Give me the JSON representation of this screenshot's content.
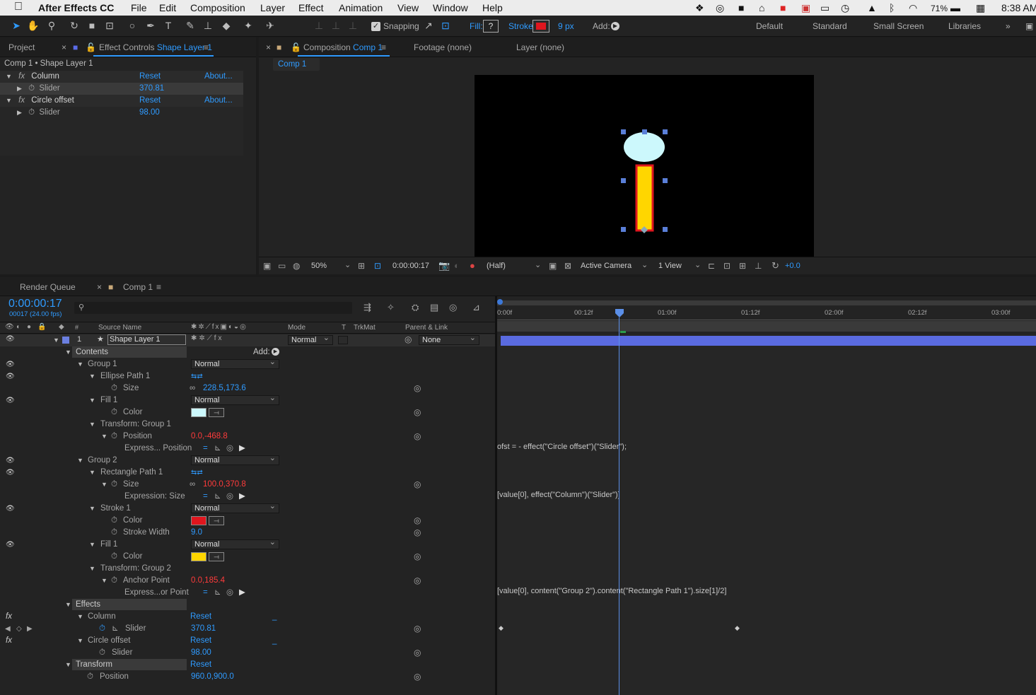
{
  "menubar": {
    "app": "After Effects CC",
    "items": [
      "File",
      "Edit",
      "Composition",
      "Layer",
      "Effect",
      "Animation",
      "View",
      "Window",
      "Help"
    ],
    "battery": "71%",
    "clock": "8:38 AM"
  },
  "toolbar": {
    "snapping": "Snapping",
    "fill": "Fill:",
    "fill_value": "?",
    "stroke": "Stroke:",
    "stroke_px": "9 px",
    "add": "Add:",
    "workspaces": [
      "Default",
      "Standard",
      "Small Screen",
      "Libraries"
    ],
    "stroke_color": "#e0161e"
  },
  "project_tab": "Project",
  "effect_controls": {
    "tab_prefix": "Effect Controls",
    "tab_layer": "Shape Layer 1",
    "breadcrumb": "Comp 1 • Shape Layer 1",
    "reset": "Reset",
    "about": "About...",
    "effects": [
      {
        "name": "Column",
        "prop": "Slider",
        "value": "370.81"
      },
      {
        "name": "Circle offset",
        "prop": "Slider",
        "value": "98.00"
      }
    ]
  },
  "composition": {
    "tab_prefix": "Composition",
    "tab_comp": "Comp 1",
    "footage": "Footage (none)",
    "layer": "Layer (none)",
    "comp_chip": "Comp 1",
    "zoom": "50%",
    "time": "0:00:00:17",
    "resolution": "(Half)",
    "camera": "Active Camera",
    "views": "1 View",
    "exposure": "+0.0",
    "colors": {
      "circle": "#ccf8fc",
      "rect": "#ffd600",
      "rect_stroke": "#e0161e"
    }
  },
  "timeline": {
    "render_queue": "Render Queue",
    "comp_tab": "Comp 1",
    "timecode": "0:00:00:17",
    "frames": "00017 (24.00 fps)",
    "columns": {
      "source_name": "Source Name",
      "mode": "Mode",
      "t": "T",
      "trkmat": "TrkMat",
      "parent": "Parent & Link"
    },
    "ruler": [
      "0:00f",
      "00:12f",
      "01:00f",
      "01:12f",
      "02:00f",
      "02:12f",
      "03:00f"
    ],
    "layer": {
      "num": "1",
      "name": "Shape Layer 1",
      "mode": "Normal",
      "parent": "None"
    },
    "contents": "Contents",
    "add": "Add:",
    "normal": "Normal",
    "group1": "Group 1",
    "ellipse_path": "Ellipse Path 1",
    "size": "Size",
    "size1": "228.5,173.6",
    "fill1": "Fill 1",
    "color": "Color",
    "transform_g1": "Transform: Group 1",
    "position": "Position",
    "pos_g1": "0.0,-468.8",
    "expr_pos": "Express... Position",
    "expr_pos_text": "ofst = - effect(\"Circle offset\")(\"Slider\");",
    "group2": "Group 2",
    "rect_path": "Rectangle Path 1",
    "size2": "100.0,370.8",
    "expr_size": "Expression: Size",
    "expr_size_text": "[value[0], effect(\"Column\")(\"Slider\")]",
    "stroke1": "Stroke 1",
    "stroke_width": "Stroke Width",
    "sw_value": "9.0",
    "transform_g2": "Transform: Group 2",
    "anchor": "Anchor Point",
    "anchor_value": "0.0,185.4",
    "expr_anchor": "Express...or Point",
    "expr_anchor_text": "[value[0], content(\"Group 2\").content(\"Rectangle Path 1\").size[1]/2]",
    "effects": "Effects",
    "column": "Column",
    "reset": "Reset",
    "slider": "Slider",
    "col_value": "370.81",
    "circle_offset": "Circle offset",
    "circ_value": "98.00",
    "transform": "Transform",
    "position_value": "960.0,900.0",
    "swatch_colors": {
      "fill1": "#ccf8fc",
      "stroke1": "#e0161e",
      "fill2": "#ffd600"
    }
  }
}
